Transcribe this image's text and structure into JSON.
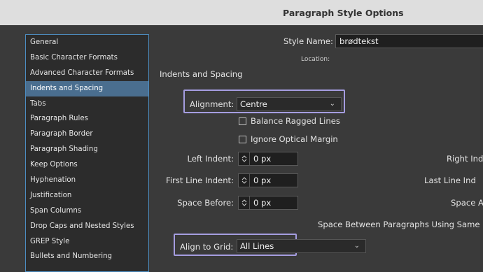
{
  "window": {
    "title": "Paragraph Style Options"
  },
  "sidebar": {
    "items": [
      {
        "label": "General"
      },
      {
        "label": "Basic Character Formats"
      },
      {
        "label": "Advanced Character Formats"
      },
      {
        "label": "Indents and Spacing",
        "selected": true
      },
      {
        "label": "Tabs"
      },
      {
        "label": "Paragraph Rules"
      },
      {
        "label": "Paragraph Border"
      },
      {
        "label": "Paragraph Shading"
      },
      {
        "label": "Keep Options"
      },
      {
        "label": "Hyphenation"
      },
      {
        "label": "Justification"
      },
      {
        "label": "Span Columns"
      },
      {
        "label": "Drop Caps and Nested Styles"
      },
      {
        "label": "GREP Style"
      },
      {
        "label": "Bullets and Numbering"
      }
    ]
  },
  "form": {
    "style_name_label": "Style Name:",
    "style_name_value": "brødtekst",
    "location_label": "Location:",
    "section_title": "Indents and Spacing",
    "alignment_label": "Alignment:",
    "alignment_value": "Centre",
    "balance_ragged_label": "Balance Ragged Lines",
    "ignore_optical_label": "Ignore Optical Margin",
    "left_indent_label": "Left Indent:",
    "left_indent_value": "0 px",
    "right_indent_label": "Right Ind",
    "first_line_label": "First Line Indent:",
    "first_line_value": "0 px",
    "last_line_label": "Last Line Ind",
    "space_before_label": "Space Before:",
    "space_before_value": "0 px",
    "space_after_label": "Space A",
    "space_between_label": "Space Between Paragraphs Using Same S",
    "align_grid_label": "Align to Grid:",
    "align_grid_value": "All Lines"
  },
  "colors": {
    "highlight": "#a59de0",
    "selection": "#4a6e8f",
    "sidebar_border": "#4c8dc1"
  }
}
